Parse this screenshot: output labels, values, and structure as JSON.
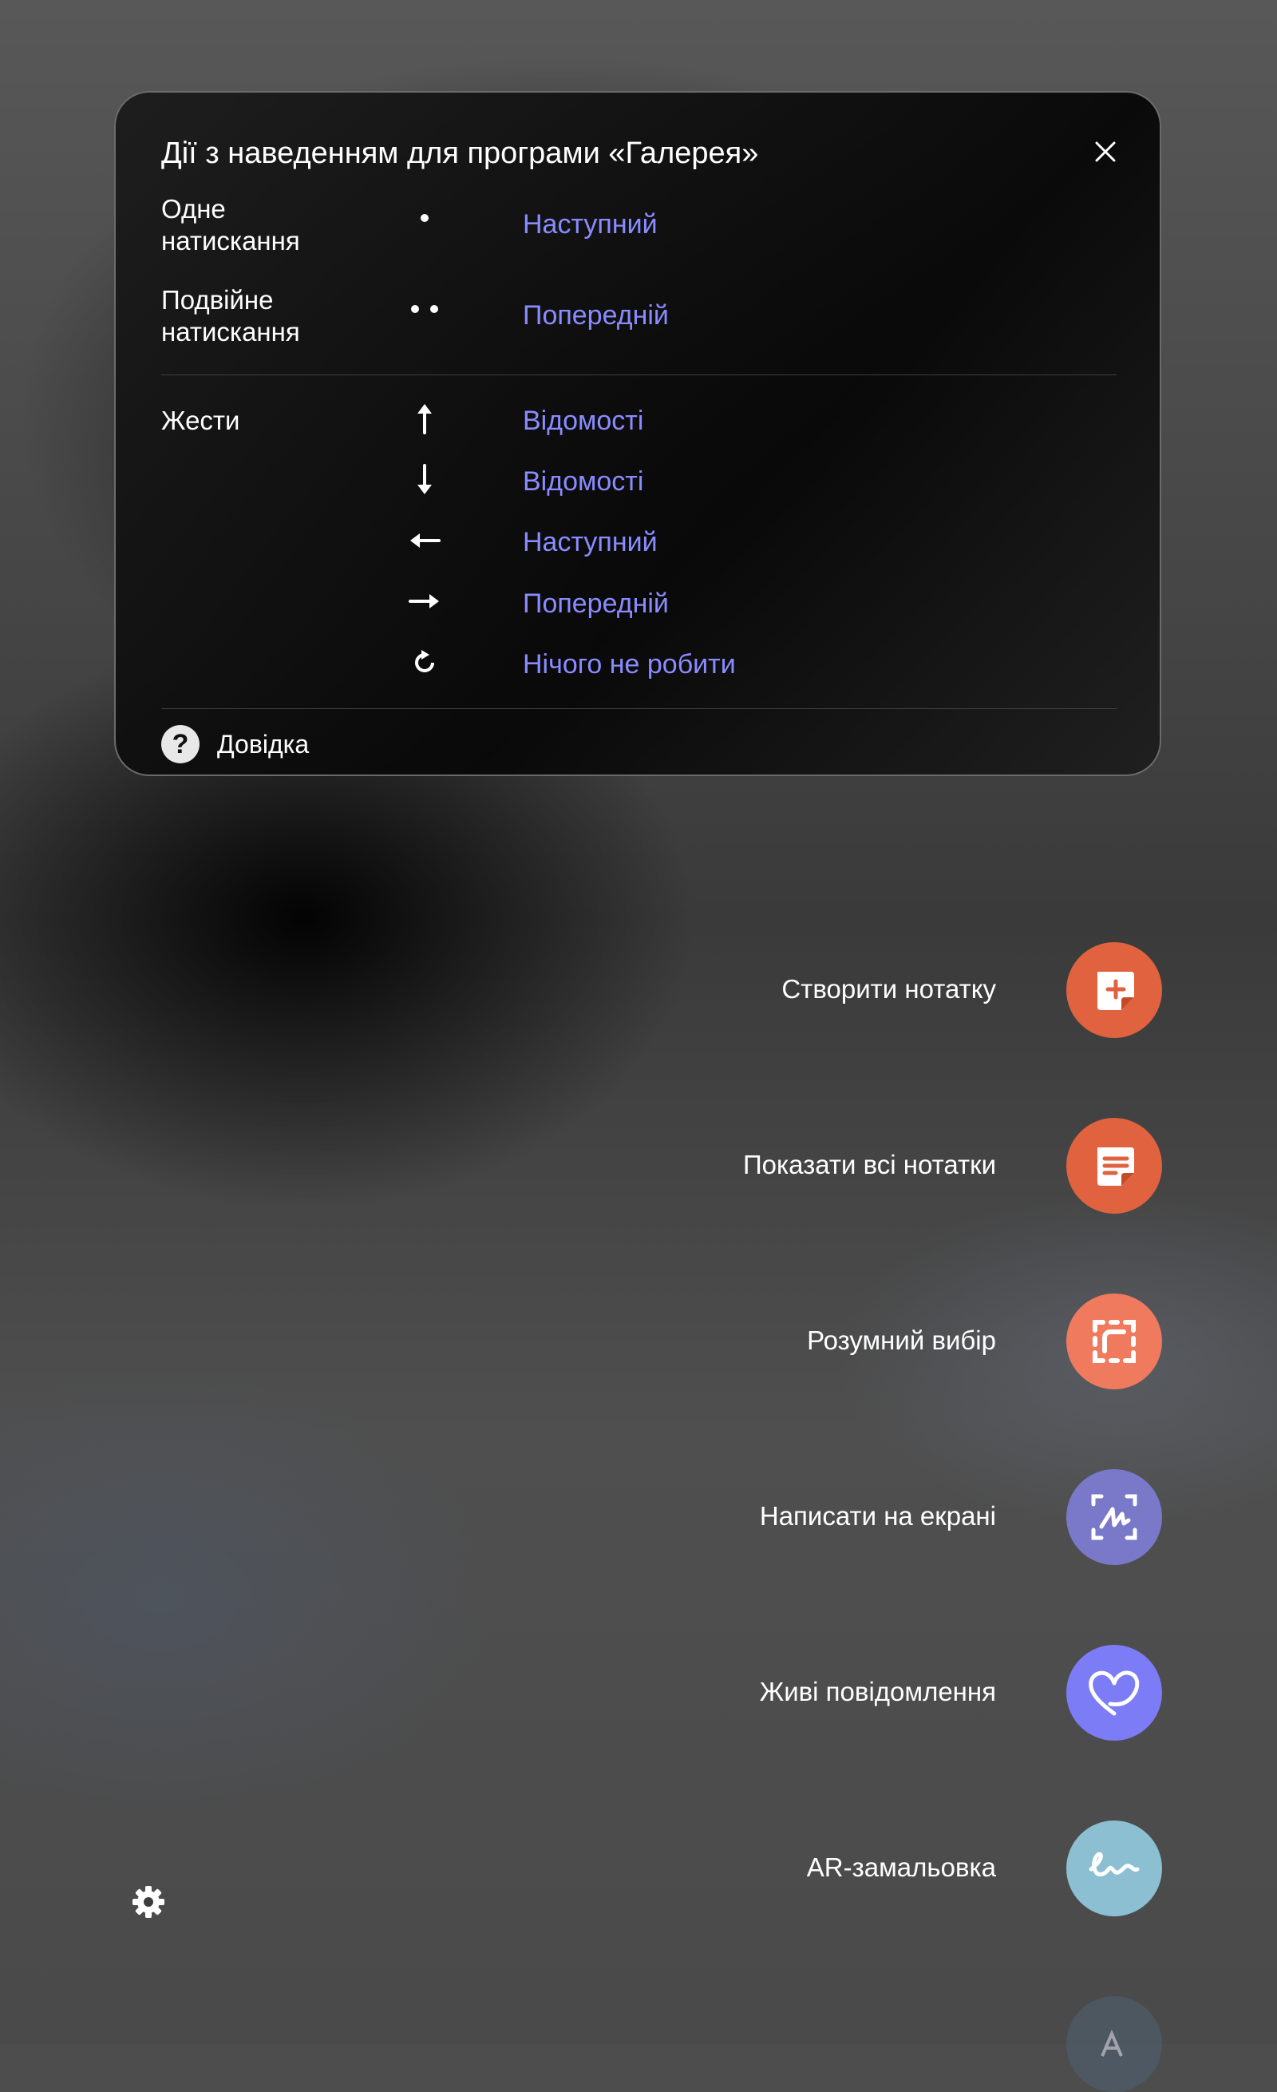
{
  "popup": {
    "title": "Дії з наведенням для програми «Галерея»",
    "close_icon": "close-icon",
    "taps": [
      {
        "label": "Одне натискання",
        "icon": "single-dot-icon",
        "action": "Наступний"
      },
      {
        "label": "Подвійне натискання",
        "icon": "double-dot-icon",
        "action": "Попередній"
      }
    ],
    "gestures_label": "Жести",
    "gestures": [
      {
        "icon": "arrow-up-icon",
        "action": "Відомості"
      },
      {
        "icon": "arrow-down-icon",
        "action": "Відомості"
      },
      {
        "icon": "arrow-left-icon",
        "action": "Наступний"
      },
      {
        "icon": "arrow-right-icon",
        "action": "Попередній"
      },
      {
        "icon": "rotate-icon",
        "action": "Нічого не робити"
      }
    ],
    "help_label": "Довідка",
    "action_color": "#8a8bff"
  },
  "air_command": {
    "items": [
      {
        "label": "Створити нотатку",
        "icon": "note-add-icon",
        "color": "#e0623e"
      },
      {
        "label": "Показати всі нотатки",
        "icon": "notes-list-icon",
        "color": "#e0623e"
      },
      {
        "label": "Розумний вибір",
        "icon": "smart-select-icon",
        "color": "#ef7a5e"
      },
      {
        "label": "Написати на екрані",
        "icon": "screen-write-icon",
        "color": "#7a78c9"
      },
      {
        "label": "Живі повідомлення",
        "icon": "heart-icon",
        "color": "#7b7cf6"
      },
      {
        "label": "AR-замальовка",
        "icon": "ar-doodle-icon",
        "color": "#8bbfd1"
      }
    ],
    "settings_icon": "gear-icon"
  }
}
